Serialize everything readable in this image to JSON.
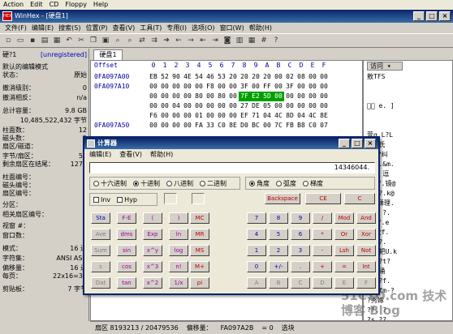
{
  "host_menu": [
    "Action",
    "Edit",
    "CD",
    "Floppy",
    "Help"
  ],
  "app_title": "WinHex - [硬盘1]",
  "menu": [
    "文件(F)",
    "编辑(E)",
    "搜索(S)",
    "位置(P)",
    "查看(V)",
    "工具(T)",
    "专用(I)",
    "选项(O)",
    "窗口(W)",
    "帮助(H)"
  ],
  "tab": "硬盘1",
  "sidebar": {
    "disk": "硬?1",
    "unregistered": "[unregistered]",
    "rows": [
      [
        "默认的编辑模式",
        ""
      ],
      [
        "状态：",
        "原始"
      ],
      [
        "撤消级别：",
        "0"
      ],
      [
        "撤消相反：",
        "n/a"
      ],
      [
        "总计容量：",
        "9.8 GB"
      ],
      [
        "",
        "10,485,522,432 字节"
      ],
      [
        "柱面数：",
        "12"
      ],
      [
        "磁头数：",
        "2"
      ],
      [
        "扇区/磁道：",
        ""
      ],
      [
        "字节/扇区：",
        "51"
      ],
      [
        "剩余扇区在结尾：",
        "1272"
      ],
      [
        "柱面编号：",
        ""
      ],
      [
        "磁头编号：",
        ""
      ],
      [
        "扇区编号：",
        ""
      ],
      [
        "分区：",
        ""
      ],
      [
        "相关扇区编号：",
        ""
      ],
      [
        "视窗 #：",
        ""
      ],
      [
        "窗口数：",
        ""
      ],
      [
        "模式：",
        "16 进"
      ],
      [
        "字符集：",
        "ANSI ASC"
      ],
      [
        "偏移量：",
        "16 进"
      ],
      [
        "每页：",
        "22x16=35"
      ],
      [
        "剪贴板：",
        "7 字节"
      ]
    ]
  },
  "hex": {
    "header": [
      "Offset",
      "0",
      "1",
      "2",
      "3",
      "4",
      "5",
      "6",
      "7",
      "8",
      "9",
      "A",
      "B",
      "C",
      "D",
      "E",
      "F"
    ],
    "rows": [
      [
        "0FA097A00",
        "EB",
        "52",
        "90",
        "4E",
        "54",
        "46",
        "53",
        "20",
        "20",
        "20",
        "20",
        "00",
        "02",
        "08",
        "00",
        "00"
      ],
      [
        "0FA097A10",
        "00",
        "00",
        "00",
        "00",
        "00",
        "F8",
        "00",
        "00",
        "3F",
        "00",
        "FF",
        "00",
        "3F",
        "00",
        "00",
        "00"
      ],
      [
        "",
        "00",
        "00",
        "00",
        "00",
        "80",
        "00",
        "80",
        "00",
        "7F",
        "E2",
        "5D",
        "00",
        "00",
        "00",
        "00",
        "00"
      ],
      [
        "",
        "00",
        "00",
        "04",
        "00",
        "00",
        "00",
        "00",
        "00",
        "27",
        "DE",
        "05",
        "00",
        "00",
        "00",
        "00",
        "00"
      ],
      [
        "",
        "F6",
        "00",
        "00",
        "00",
        "01",
        "00",
        "00",
        "00",
        "EF",
        "71",
        "04",
        "4C",
        "8D",
        "04",
        "4C",
        "8E"
      ],
      [
        "0FA097A50",
        "00",
        "00",
        "00",
        "00",
        "FA",
        "33",
        "C0",
        "8E",
        "D0",
        "BC",
        "00",
        "7C",
        "FB",
        "B8",
        "C0",
        "07"
      ]
    ],
    "highlight": "7F E2 5D 00"
  },
  "ascii": {
    "selector": "访问",
    "rows": [
      "敫TFS",
      "",
      "",
      "\u0000\u0000 e.  ]",
      "",
      "",
      "萱q.L?L",
      "?0 氏 ",
      "?幕?纠",
      " .hj.&m.",
      "?.$ 逗",
      "?矮f.镜@",
      "Af.?.k@",
      "?魔嵊理.",
      "f?? ?.",
      "?心f.e",
      "s?妆f.",
      "F.l?.",
      "k?.耙U.k",
      "?..?t?",
      "???涌",
      "?f.?f.",
      "?%.fm-?",
      "?秀嫁",
      "?f. ?",
      "?s.??"
    ]
  },
  "calculator": {
    "title": "计算器",
    "menu": [
      "编辑(E)",
      "查看(V)",
      "帮助(H)"
    ],
    "display": "14346044.",
    "bases": [
      "十六进制",
      "十进制",
      "八进制",
      "二进制"
    ],
    "angles": [
      "角度",
      "弧度",
      "梯度"
    ],
    "inv": "Inv",
    "hyp": "Hyp",
    "backspace": "Backspace",
    "ce": "CE",
    "c": "C",
    "sci": [
      [
        "Sta",
        "F-E",
        "(",
        ")"
      ],
      [
        "Ave",
        "dms",
        "Exp",
        "ln"
      ],
      [
        "Sum",
        "sin",
        "x^y",
        "log"
      ],
      [
        "s",
        "cos",
        "x^3",
        "n!"
      ],
      [
        "Dat",
        "tan",
        "x^2",
        "1/x"
      ]
    ],
    "mem": [
      "MC",
      "MR",
      "MS",
      "M+",
      "pi"
    ],
    "num": [
      [
        "7",
        "8",
        "9",
        "/",
        "Mod",
        "And"
      ],
      [
        "4",
        "5",
        "6",
        "*",
        "Or",
        "Xor"
      ],
      [
        "1",
        "2",
        "3",
        "-",
        "Lsh",
        "Not"
      ],
      [
        "0",
        "+/-",
        ".",
        "+",
        "=",
        "Int"
      ],
      [
        "A",
        "B",
        "C",
        "D",
        "E",
        "F"
      ]
    ]
  },
  "status": {
    "sector": "扇区 8193213 / 20479536",
    "offset_label": "偏移量：",
    "offset": "FA097A2B",
    "eq": "= 0",
    "sel": "选块"
  },
  "watermark": "51CTO.com 技术博客 Blog"
}
